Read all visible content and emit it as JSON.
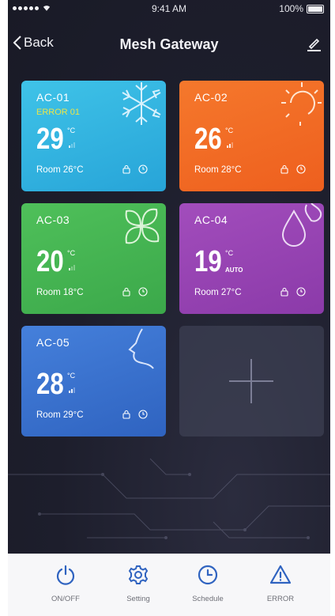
{
  "status_bar": {
    "time": "9:41 AM",
    "battery": "100%"
  },
  "nav": {
    "back_label": "Back",
    "title": "Mesh Gateway"
  },
  "cards": [
    {
      "name": "AC-01",
      "error": "ERROR 01",
      "temp": "29",
      "unit": "°C",
      "room": "Room 26°C",
      "icon": "snowflake-icon",
      "signal_level": 1
    },
    {
      "name": "AC-02",
      "temp": "26",
      "unit": "°C",
      "room": "Room 28°C",
      "icon": "sun-icon",
      "signal_level": 2
    },
    {
      "name": "AC-03",
      "temp": "20",
      "unit": "°C",
      "room": "Room 18°C",
      "icon": "fan-icon",
      "signal_level": 1
    },
    {
      "name": "AC-04",
      "temp": "19",
      "unit": "°C",
      "mode": "AUTO",
      "room": "Room 27°C",
      "icon": "water-drop-icon"
    },
    {
      "name": "AC-05",
      "temp": "28",
      "unit": "°C",
      "room": "Room 29°C",
      "icon": "face-profile-icon",
      "signal_level": 2
    }
  ],
  "tabbar": {
    "onoff": "ON/OFF",
    "setting": "Setting",
    "schedule": "Schedule",
    "error": "ERROR"
  },
  "colors": {
    "background": "#1d1e2c",
    "accent_blue": "#2f63c0",
    "card_cyan": "#3fc3e8",
    "card_orange": "#f5782c",
    "card_green": "#4fc05a",
    "card_purple": "#a24dbc",
    "card_blue": "#4580db"
  }
}
